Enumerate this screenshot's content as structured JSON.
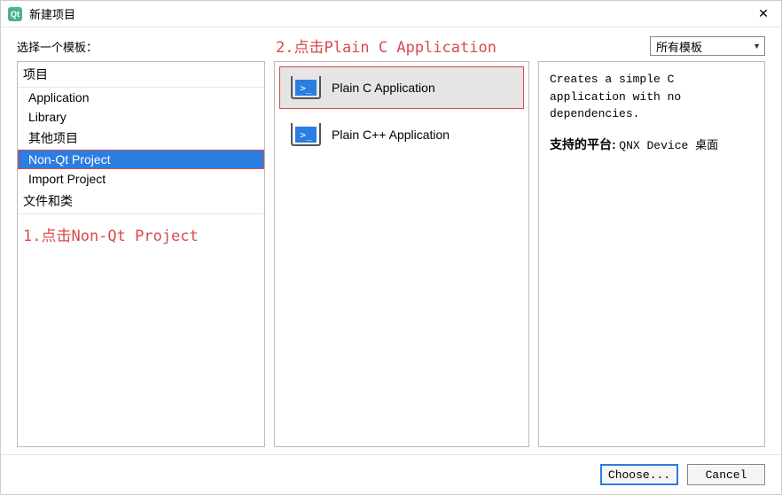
{
  "window": {
    "icon_text": "Qt",
    "title": "新建项目"
  },
  "toprow": {
    "label": "选择一个模板：",
    "filter_selected": "所有模板"
  },
  "annotations": {
    "step1": "1.点击Non-Qt Project",
    "step2": "2.点击Plain C Application"
  },
  "categories": {
    "header1": "项目",
    "items1": [
      "Application",
      "Library",
      "其他项目",
      "Non-Qt Project",
      "Import Project"
    ],
    "selected1": "Non-Qt Project",
    "header2": "文件和类"
  },
  "templates": {
    "items": [
      {
        "label": "Plain C Application",
        "selected": true
      },
      {
        "label": "Plain C++ Application",
        "selected": false
      }
    ],
    "icon_glyph": ">_"
  },
  "description": {
    "text": "Creates a simple C application with no dependencies.",
    "platforms_label": "支持的平台:",
    "platforms_value": "QNX Device 桌面"
  },
  "footer": {
    "choose": "Choose...",
    "cancel": "Cancel"
  }
}
